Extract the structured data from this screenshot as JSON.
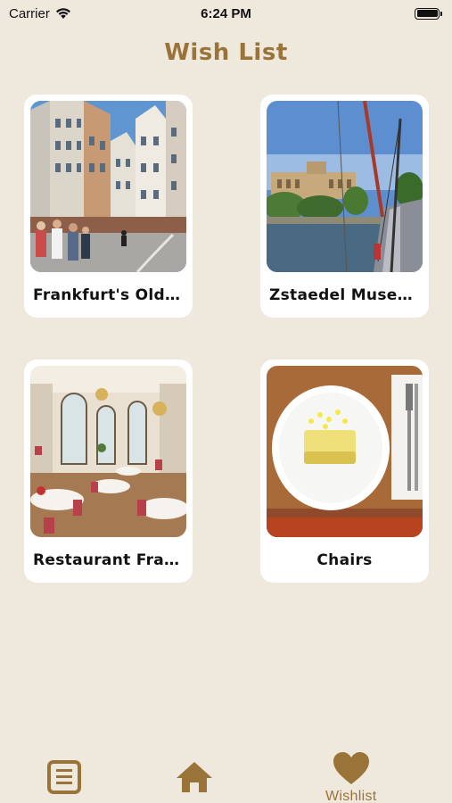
{
  "status_bar": {
    "carrier": "Carrier",
    "time": "6:24 PM"
  },
  "header": {
    "title": "Wish List"
  },
  "cards": [
    {
      "label": "Frankfurt's Old …",
      "image": "frankfurt-old-town-photo"
    },
    {
      "label": "Zstaedel Museum",
      "image": "staedel-museum-photo"
    },
    {
      "label": "Restaurant Fran…",
      "image": "restaurant-interior-photo"
    },
    {
      "label": "Chairs",
      "image": "plated-dish-photo"
    }
  ],
  "tab_bar": {
    "items": [
      {
        "icon": "list-document-icon",
        "label": ""
      },
      {
        "icon": "home-icon",
        "label": ""
      },
      {
        "icon": "heart-icon",
        "label": "Wishlist",
        "active": true
      }
    ]
  },
  "colors": {
    "background": "#efe8dd",
    "accent": "#9a7338",
    "card": "#ffffff"
  }
}
